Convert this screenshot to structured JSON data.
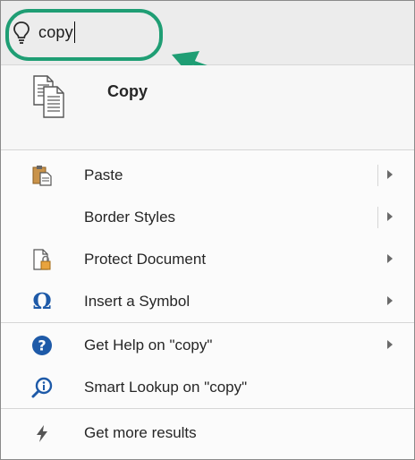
{
  "search": {
    "query": "copy"
  },
  "top_result": {
    "label": "Copy",
    "icon": "copy-icon"
  },
  "items": [
    {
      "label": "Paste",
      "icon": "paste-icon",
      "submenu": true,
      "split": true
    },
    {
      "label": "Border Styles",
      "icon": "",
      "submenu": true,
      "split": true
    },
    {
      "label": "Protect Document",
      "icon": "lock-document-icon",
      "submenu": true,
      "split": false
    },
    {
      "label": "Insert a Symbol",
      "icon": "omega-icon",
      "submenu": true,
      "split": false
    },
    {
      "label": "Get Help on \"copy\"",
      "icon": "help-icon",
      "submenu": true,
      "split": false
    },
    {
      "label": "Smart Lookup on \"copy\"",
      "icon": "smart-lookup-icon",
      "submenu": false,
      "split": false
    },
    {
      "label": "Get more results",
      "icon": "lightning-icon",
      "submenu": false,
      "split": false
    }
  ],
  "colors": {
    "annotation": "#1f9e74",
    "help_blue": "#1e5aa8",
    "search_bg": "#ececec"
  }
}
